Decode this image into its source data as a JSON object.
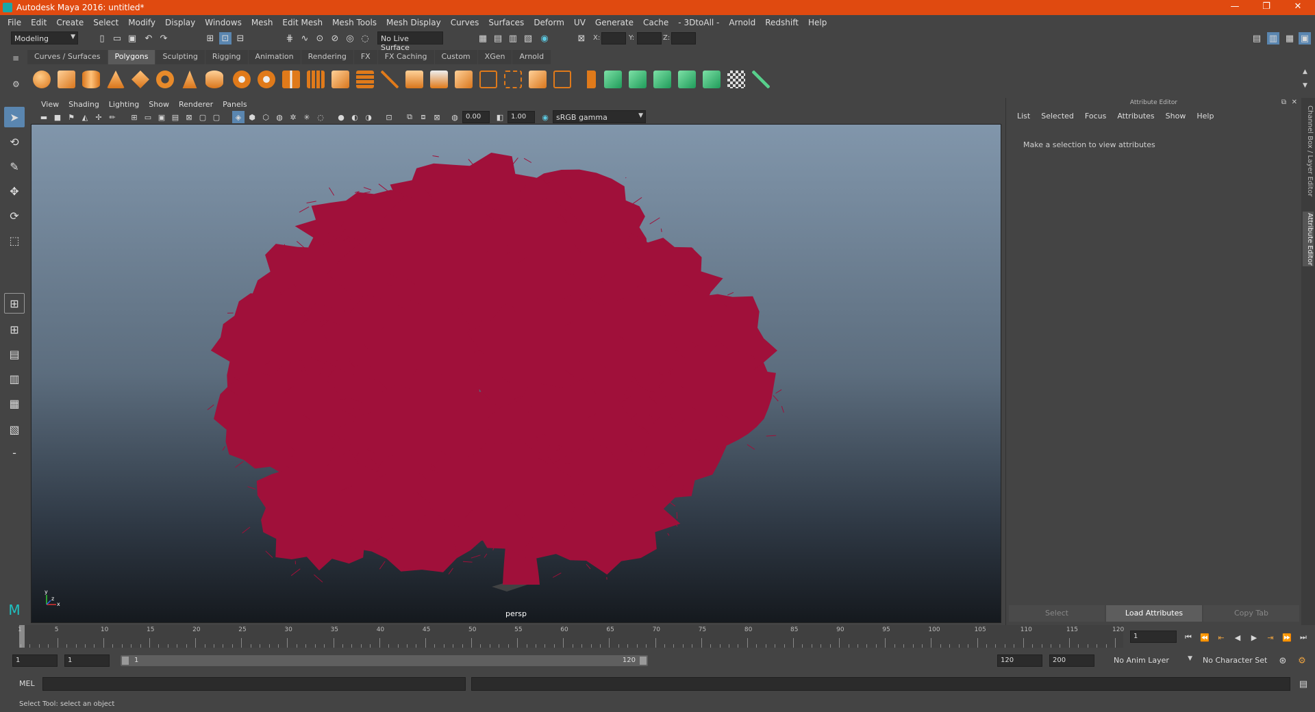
{
  "window": {
    "title": "Autodesk Maya 2016: untitled*",
    "controls": [
      "—",
      "❐",
      "✕"
    ]
  },
  "menubar": [
    "File",
    "Edit",
    "Create",
    "Select",
    "Modify",
    "Display",
    "Windows",
    "Mesh",
    "Edit Mesh",
    "Mesh Tools",
    "Mesh Display",
    "Curves",
    "Surfaces",
    "Deform",
    "UV",
    "Generate",
    "Cache",
    "- 3DtoAll -",
    "Arnold",
    "Redshift",
    "Help"
  ],
  "statusline": {
    "mode": "Modeling",
    "live_surface": "No Live Surface",
    "coord_labels": [
      "X:",
      "Y:",
      "Z:"
    ]
  },
  "shelf": {
    "tabs": [
      "Curves / Surfaces",
      "Polygons",
      "Sculpting",
      "Rigging",
      "Animation",
      "Rendering",
      "FX",
      "FX Caching",
      "Custom",
      "XGen",
      "Arnold"
    ],
    "active_tab": "Polygons"
  },
  "viewport": {
    "menu": [
      "View",
      "Shading",
      "Lighting",
      "Show",
      "Renderer",
      "Panels"
    ],
    "exposure": "0.00",
    "gamma": "1.00",
    "color_space": "sRGB gamma",
    "camera_label": "persp",
    "axis_labels": [
      "y",
      "x",
      "z"
    ],
    "wireframe_color": "#a0103a"
  },
  "attribute_editor": {
    "title": "Attribute Editor",
    "menu": [
      "List",
      "Selected",
      "Focus",
      "Attributes",
      "Show",
      "Help"
    ],
    "message": "Make a selection to view attributes",
    "buttons": [
      "Select",
      "Load Attributes",
      "Copy Tab"
    ],
    "side_tabs": [
      "Channel Box / Layer Editor",
      "Attribute Editor"
    ]
  },
  "timeslider": {
    "tick_labels": [
      "1",
      "5",
      "10",
      "15",
      "20",
      "25",
      "30",
      "35",
      "40",
      "45",
      "50",
      "55",
      "60",
      "65",
      "70",
      "75",
      "80",
      "85",
      "90",
      "95",
      "100",
      "105",
      "110",
      "115",
      "120"
    ],
    "current_frame": "1"
  },
  "rangeslider": {
    "start": "1",
    "anim_start": "1",
    "slider_start": "1",
    "slider_end": "120",
    "range_end": "120",
    "anim_end": "200",
    "anim_layer": "No Anim Layer",
    "character_set": "No Character Set"
  },
  "cmdline": {
    "label": "MEL"
  },
  "helpline": {
    "text": "Select Tool: select an object"
  }
}
